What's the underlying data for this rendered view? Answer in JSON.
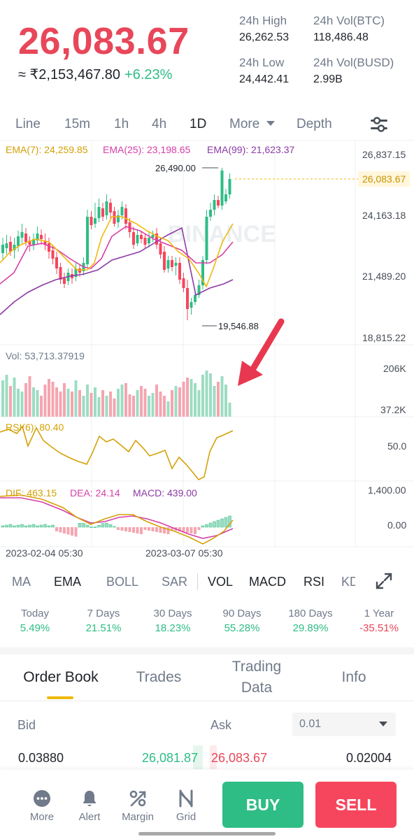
{
  "header": {
    "last_price": "26,083.67",
    "fiat_price": "≈ ₹2,153,467.80",
    "change_pct": "+6.23%",
    "stats": [
      {
        "label": "24h High",
        "value": "26,262.53"
      },
      {
        "label": "24h Vol(BTC)",
        "value": "118,486.48"
      },
      {
        "label": "24h Low",
        "value": "24,442.41"
      },
      {
        "label": "24h Vol(BUSD)",
        "value": "2.99B"
      }
    ]
  },
  "intervals": {
    "items": [
      "Line",
      "15m",
      "1h",
      "4h",
      "1D",
      "More",
      "Depth"
    ],
    "active": "1D",
    "settings_icon": "sliders-icon"
  },
  "chart": {
    "ema_legend": {
      "ema7": "EMA(7): 24,259.85",
      "ema25": "EMA(25): 23,198.65",
      "ema99": "EMA(99): 21,623.37"
    },
    "price_axis": [
      "26,837.15",
      "24,163.18",
      "21,489.20",
      "18,815.22"
    ],
    "current_price_tag": "26,083.67",
    "high_marker": "26,490.00",
    "low_marker": "19,546.88",
    "watermark": "BINANCE",
    "vol_legend": "Vol: 53,713.37919",
    "vol_axis": [
      "206K",
      "37.2K"
    ],
    "rsi_legend": "RSI(6): 80.40",
    "rsi_axis": [
      "50.0"
    ],
    "macd_legend": {
      "dif": "DIF: 463.15",
      "dea": "DEA: 24.14",
      "macd": "MACD: 439.00"
    },
    "macd_axis": [
      "1,400.00",
      "0.00"
    ],
    "time_axis": [
      "2023-02-04 05:30",
      "2023-03-07 05:30"
    ],
    "colors": {
      "up": "#2ebd85",
      "down": "#f6465d",
      "ema7": "#f0b90b",
      "ema25": "#d63fa8",
      "ema99": "#8c3aa6",
      "arrow": "#e8384f"
    }
  },
  "indicators": {
    "items": [
      "MA",
      "EMA",
      "BOLL",
      "SAR",
      "VOL",
      "MACD",
      "RSI",
      "KD"
    ],
    "active": [
      "EMA",
      "VOL",
      "MACD",
      "RSI"
    ],
    "expand_icon": "expand-icon"
  },
  "performance": [
    {
      "label": "Today",
      "value": "5.49%",
      "color": "#2ebd85"
    },
    {
      "label": "7 Days",
      "value": "21.51%",
      "color": "#2ebd85"
    },
    {
      "label": "30 Days",
      "value": "18.23%",
      "color": "#2ebd85"
    },
    {
      "label": "90 Days",
      "value": "55.28%",
      "color": "#2ebd85"
    },
    {
      "label": "180 Days",
      "value": "29.89%",
      "color": "#2ebd85"
    },
    {
      "label": "1 Year",
      "value": "-35.51%",
      "color": "#e8475a"
    }
  ],
  "book_tabs": {
    "items": [
      "Order Book",
      "Trades",
      "Trading Data",
      "Info"
    ],
    "trading_data_lines": [
      "Trading",
      "Data"
    ],
    "active": "Order Book"
  },
  "order_book": {
    "bid_label": "Bid",
    "ask_label": "Ask",
    "precision": "0.01",
    "rows": [
      {
        "bid_qty": "0.03880",
        "bid_price": "26,081.87",
        "ask_price": "26,083.67",
        "ask_qty": "0.02004"
      }
    ]
  },
  "bottom_bar": {
    "items": [
      {
        "label": "More",
        "icon": "more-icon"
      },
      {
        "label": "Alert",
        "icon": "bell-icon"
      },
      {
        "label": "Margin",
        "icon": "margin-icon"
      },
      {
        "label": "Grid",
        "icon": "grid-icon"
      }
    ],
    "buy_label": "BUY",
    "sell_label": "SELL"
  }
}
